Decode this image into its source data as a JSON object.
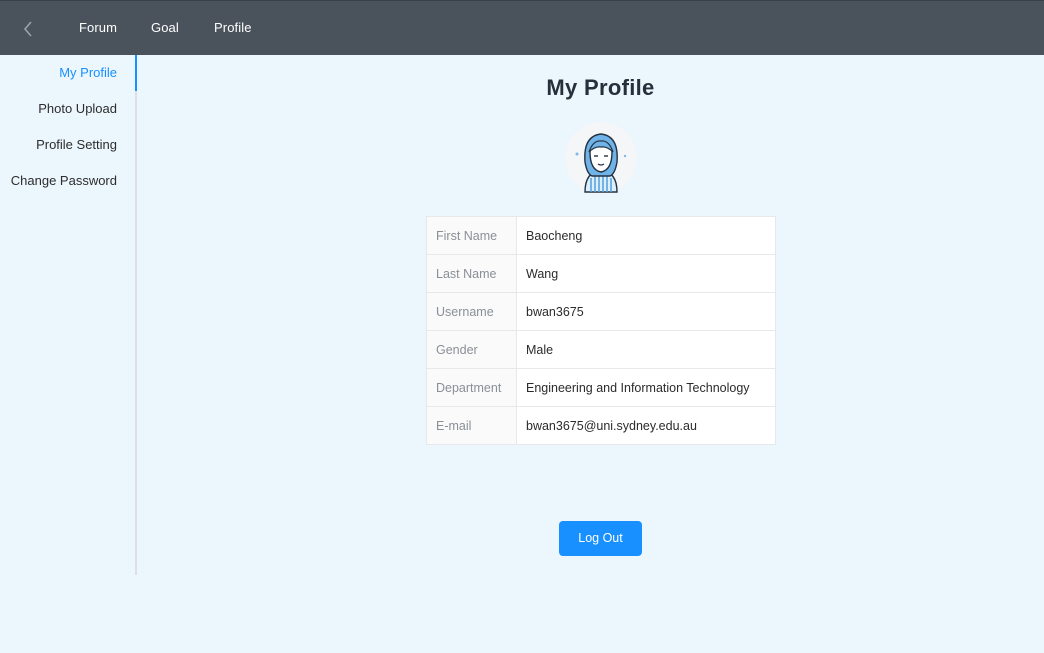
{
  "topbar": {
    "nav": [
      {
        "label": "Forum"
      },
      {
        "label": "Goal"
      },
      {
        "label": "Profile"
      }
    ]
  },
  "sidebar": {
    "items": [
      {
        "label": "My Profile",
        "active": true
      },
      {
        "label": "Photo Upload"
      },
      {
        "label": "Profile Setting"
      },
      {
        "label": "Change Password"
      }
    ]
  },
  "main": {
    "title": "My Profile",
    "fields": [
      {
        "label": "First Name",
        "value": "Baocheng"
      },
      {
        "label": "Last Name",
        "value": "Wang"
      },
      {
        "label": "Username",
        "value": "bwan3675"
      },
      {
        "label": "Gender",
        "value": "Male"
      },
      {
        "label": "Department",
        "value": "Engineering and Information Technology"
      },
      {
        "label": "E-mail",
        "value": "bwan3675@uni.sydney.edu.au"
      }
    ],
    "logout_label": "Log Out"
  },
  "colors": {
    "topbar": "#4a525c",
    "accent": "#1890ff",
    "background": "#ecf6fd"
  }
}
